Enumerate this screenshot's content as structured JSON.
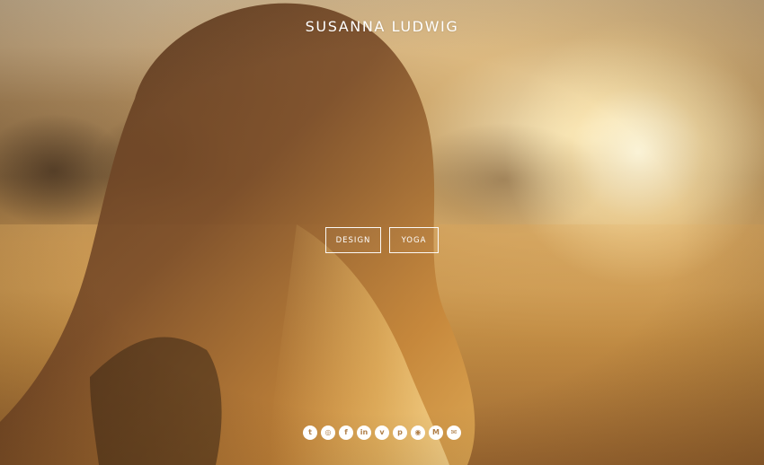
{
  "site": {
    "title": "SUSANNA LUDWIG"
  },
  "nav": {
    "items": [
      {
        "label": "DESIGN"
      },
      {
        "label": "YOGA"
      }
    ]
  },
  "social": {
    "icons": [
      {
        "name": "twitter-icon",
        "glyph": "t"
      },
      {
        "name": "instagram-icon",
        "glyph": "◎"
      },
      {
        "name": "facebook-icon",
        "glyph": "f"
      },
      {
        "name": "linkedin-icon",
        "glyph": "in"
      },
      {
        "name": "vimeo-icon",
        "glyph": "v"
      },
      {
        "name": "pinterest-icon",
        "glyph": "p"
      },
      {
        "name": "dribbble-icon",
        "glyph": "◉"
      },
      {
        "name": "medium-icon",
        "glyph": "M"
      },
      {
        "name": "email-icon",
        "glyph": "✉"
      }
    ]
  },
  "colors": {
    "text": "#ffffff",
    "icon_glyph": "#b07f48",
    "sky": "#d8c3a0",
    "field": "#c89a58"
  }
}
